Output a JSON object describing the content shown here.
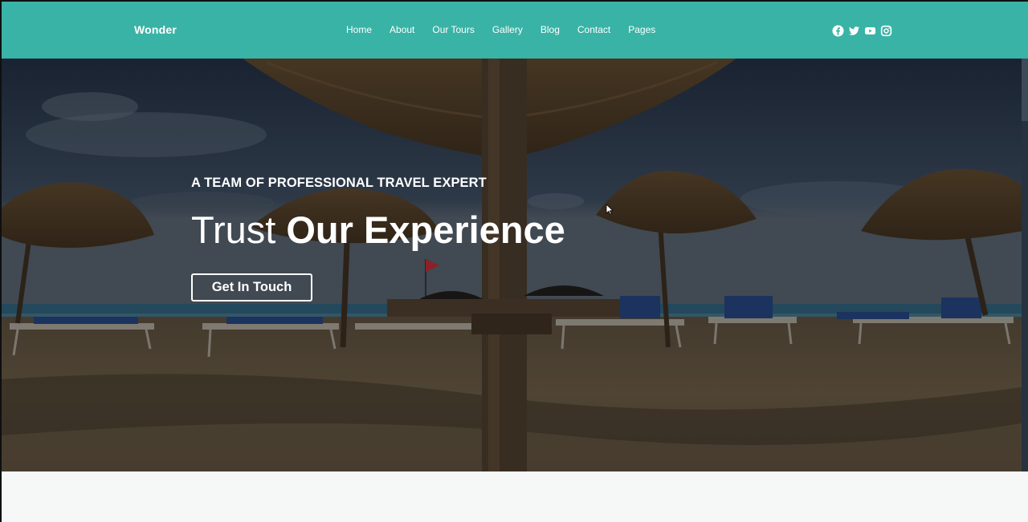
{
  "header": {
    "brand": "Wonder",
    "nav": [
      "Home",
      "About",
      "Our Tours",
      "Gallery",
      "Blog",
      "Contact",
      "Pages"
    ],
    "socials": [
      "facebook-icon",
      "twitter-icon",
      "youtube-icon",
      "instagram-icon"
    ]
  },
  "hero": {
    "kicker": "A TEAM OF PROFESSIONAL TRAVEL EXPERT",
    "headline_light": "Trust ",
    "headline_bold": "Our Experience",
    "cta_label": "Get In Touch"
  },
  "colors": {
    "header_bg": "#39b3a6",
    "text_on_hero": "#ffffff"
  }
}
